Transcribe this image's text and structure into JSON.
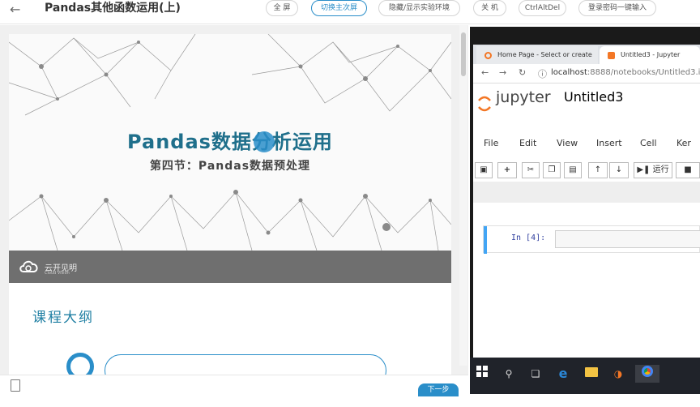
{
  "header": {
    "title": "Pandas其他函数运用(上)",
    "buttons": [
      "全 屏",
      "切换主次屏",
      "隐藏/显示实验环境",
      "关 机",
      "CtrlAltDel",
      "登录密码一键输入"
    ]
  },
  "slide": {
    "title": "Pandas数据分析运用",
    "subtitle": "第四节：Pandas数据预处理",
    "brand": "云开见明",
    "brand_sub": "Cloud Vision",
    "outline_title": "课程大纲"
  },
  "footer": {
    "next_label": "下一步"
  },
  "browser": {
    "tab1": "Home Page - Select or create",
    "tab2": "Untitled3 - Jupyter",
    "url_host": "localhost",
    "url_path": ":8888/notebooks/Untitled3.i",
    "jupyter_logo_text": "jupyter",
    "notebook_name": "Untitled3",
    "menu": [
      "File",
      "Edit",
      "View",
      "Insert",
      "Cell",
      "Ker"
    ],
    "run_label": "运行",
    "cell_prompt": "In  [4]:"
  },
  "colors": {
    "accent": "#2a8ec9",
    "jupyter_orange": "#f37726"
  }
}
